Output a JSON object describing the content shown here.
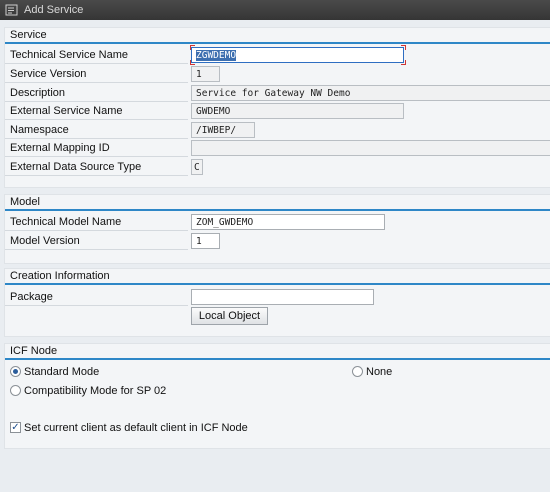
{
  "window": {
    "title": "Add Service",
    "icon": "edit-document-icon"
  },
  "service": {
    "title": "Service",
    "fields": [
      {
        "label": "Technical Service Name",
        "value": "ZGWDEMO"
      },
      {
        "label": "Service Version",
        "value": "1"
      },
      {
        "label": "Description",
        "value": "Service for Gateway NW Demo"
      },
      {
        "label": "External Service Name",
        "value": "GWDEMO"
      },
      {
        "label": "Namespace",
        "value": "/IWBEP/"
      },
      {
        "label": "External Mapping ID",
        "value": ""
      },
      {
        "label": "External Data Source Type",
        "value": "C"
      }
    ]
  },
  "model": {
    "title": "Model",
    "fields": [
      {
        "label": "Technical Model Name",
        "value": "ZOM_GWDEMO"
      },
      {
        "label": "Model Version",
        "value": "1"
      }
    ]
  },
  "creation": {
    "title": "Creation Information",
    "package_label": "Package",
    "package_value": "",
    "local_object_button": "Local Object"
  },
  "icf": {
    "title": "ICF Node",
    "options": [
      {
        "label": "Standard Mode",
        "selected": true
      },
      {
        "label": "None",
        "selected": false
      },
      {
        "label": "Compatibility Mode for SP 02",
        "selected": false
      }
    ],
    "default_client_label": "Set current client as default client in ICF Node",
    "default_client_checked": true
  },
  "colors": {
    "accent": "#2e87c7",
    "titlebar": "#3c3c3c",
    "background": "#e9edf1"
  }
}
